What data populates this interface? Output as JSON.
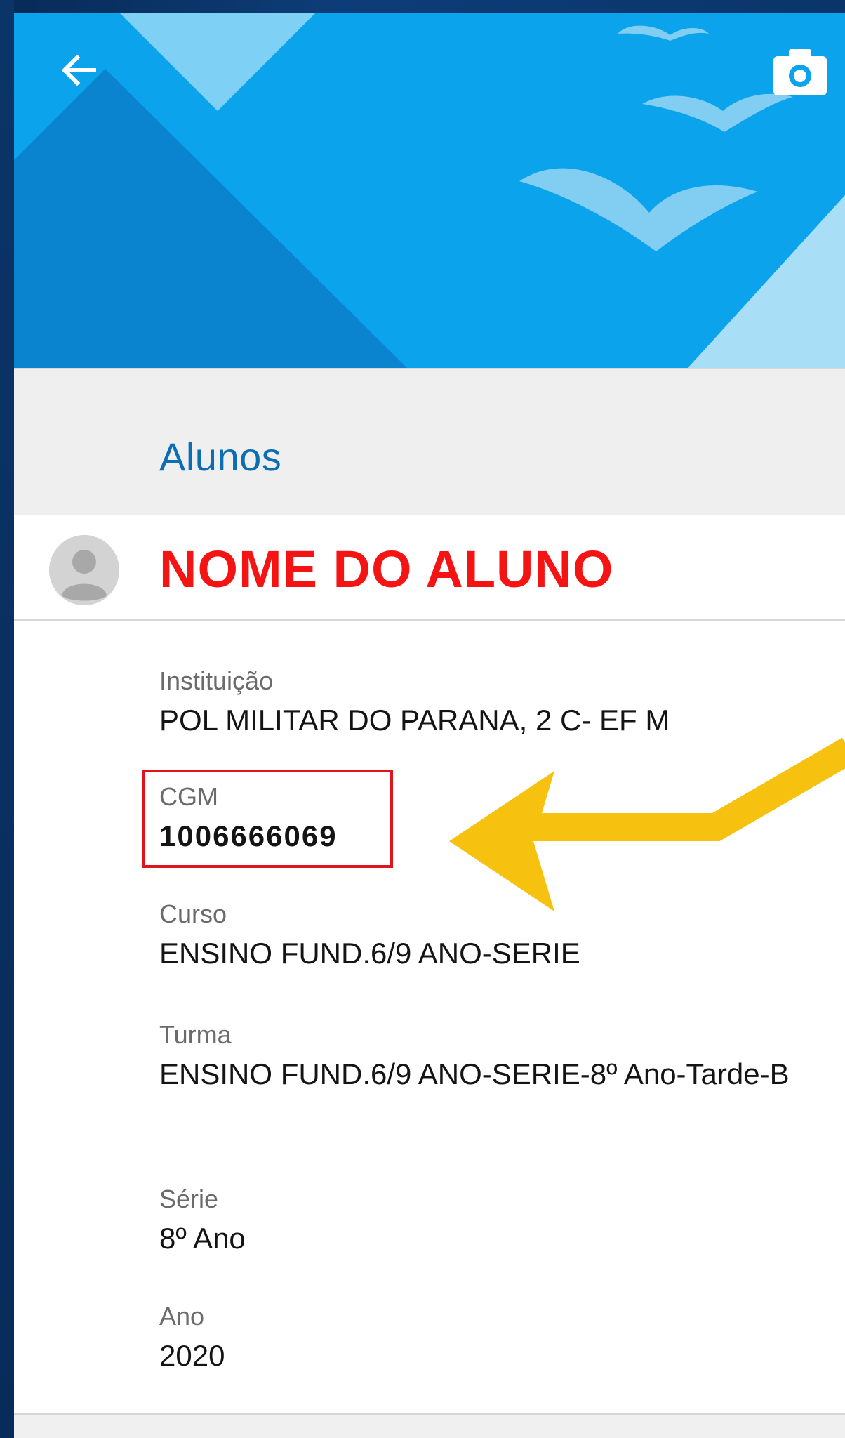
{
  "header": {
    "back_icon": "arrow-left-icon",
    "camera_icon": "camera-icon",
    "accent_color": "#0aa3ec"
  },
  "section": {
    "title": "Alunos"
  },
  "student": {
    "name": "NOME DO ALUNO",
    "avatar_icon": "person-icon",
    "name_color": "#f51414"
  },
  "fields": [
    {
      "label": "Instituição",
      "value": "POL MILITAR DO PARANA, 2 C- EF M"
    },
    {
      "label": "CGM",
      "value": "1006666069"
    },
    {
      "label": "Curso",
      "value": "ENSINO FUND.6/9 ANO-SERIE"
    },
    {
      "label": "Turma",
      "value": "ENSINO FUND.6/9 ANO-SERIE-8º Ano-Tarde-B"
    },
    {
      "label": "Série",
      "value": "8º Ano"
    },
    {
      "label": "Ano",
      "value": "2020"
    }
  ],
  "annotations": {
    "highlight_color": "#e0141c",
    "arrow_color": "#f7c20f"
  }
}
